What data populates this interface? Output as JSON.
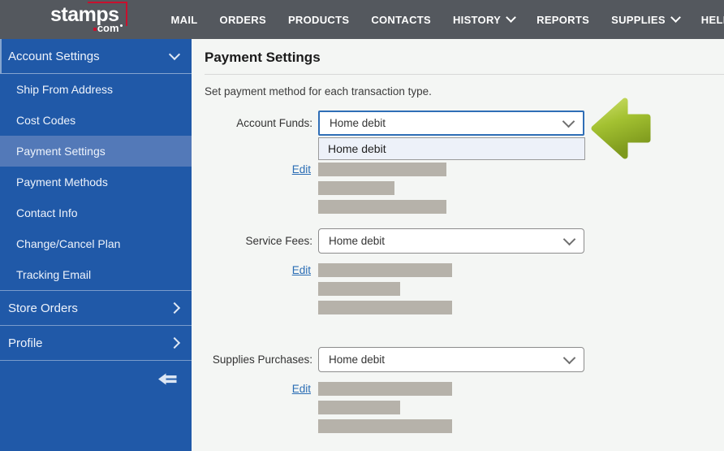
{
  "brand": {
    "name_main": "stamps",
    "name_sub": "com"
  },
  "nav": {
    "items": [
      {
        "label": "MAIL"
      },
      {
        "label": "ORDERS"
      },
      {
        "label": "PRODUCTS"
      },
      {
        "label": "CONTACTS"
      },
      {
        "label": "HISTORY",
        "has_dropdown": true
      },
      {
        "label": "REPORTS"
      },
      {
        "label": "SUPPLIES",
        "has_dropdown": true
      },
      {
        "label": "HELP"
      }
    ]
  },
  "sidebar": {
    "account_settings": {
      "label": "Account Settings",
      "expanded": true,
      "items": [
        {
          "label": "Ship From Address"
        },
        {
          "label": "Cost Codes"
        },
        {
          "label": "Payment Settings",
          "selected": true
        },
        {
          "label": "Payment Methods"
        },
        {
          "label": "Contact Info"
        },
        {
          "label": "Change/Cancel Plan"
        },
        {
          "label": "Tracking Email"
        }
      ]
    },
    "store_orders": {
      "label": "Store Orders"
    },
    "profile": {
      "label": "Profile"
    }
  },
  "main": {
    "title": "Payment Settings",
    "subtitle": "Set payment method for each transaction type.",
    "sections": [
      {
        "label": "Account Funds:",
        "value": "Home debit",
        "edit_label": "Edit",
        "dropdown_open": true,
        "options": [
          {
            "label": "Home debit"
          }
        ]
      },
      {
        "label": "Service Fees:",
        "value": "Home debit",
        "edit_label": "Edit"
      },
      {
        "label": "Supplies Purchases:",
        "value": "Home debit",
        "edit_label": "Edit"
      }
    ]
  },
  "colors": {
    "topnav": "#54585e",
    "sidebar": "#2059a8",
    "sidebar_selected": "#5379b8",
    "brand_red": "#c8102e",
    "link": "#2a6db5",
    "arrow_green": "#9cba2b",
    "focus_border": "#2f6eb6",
    "redaction_bar": "#b6b2aa",
    "page_bg": "#f4f6f4"
  }
}
